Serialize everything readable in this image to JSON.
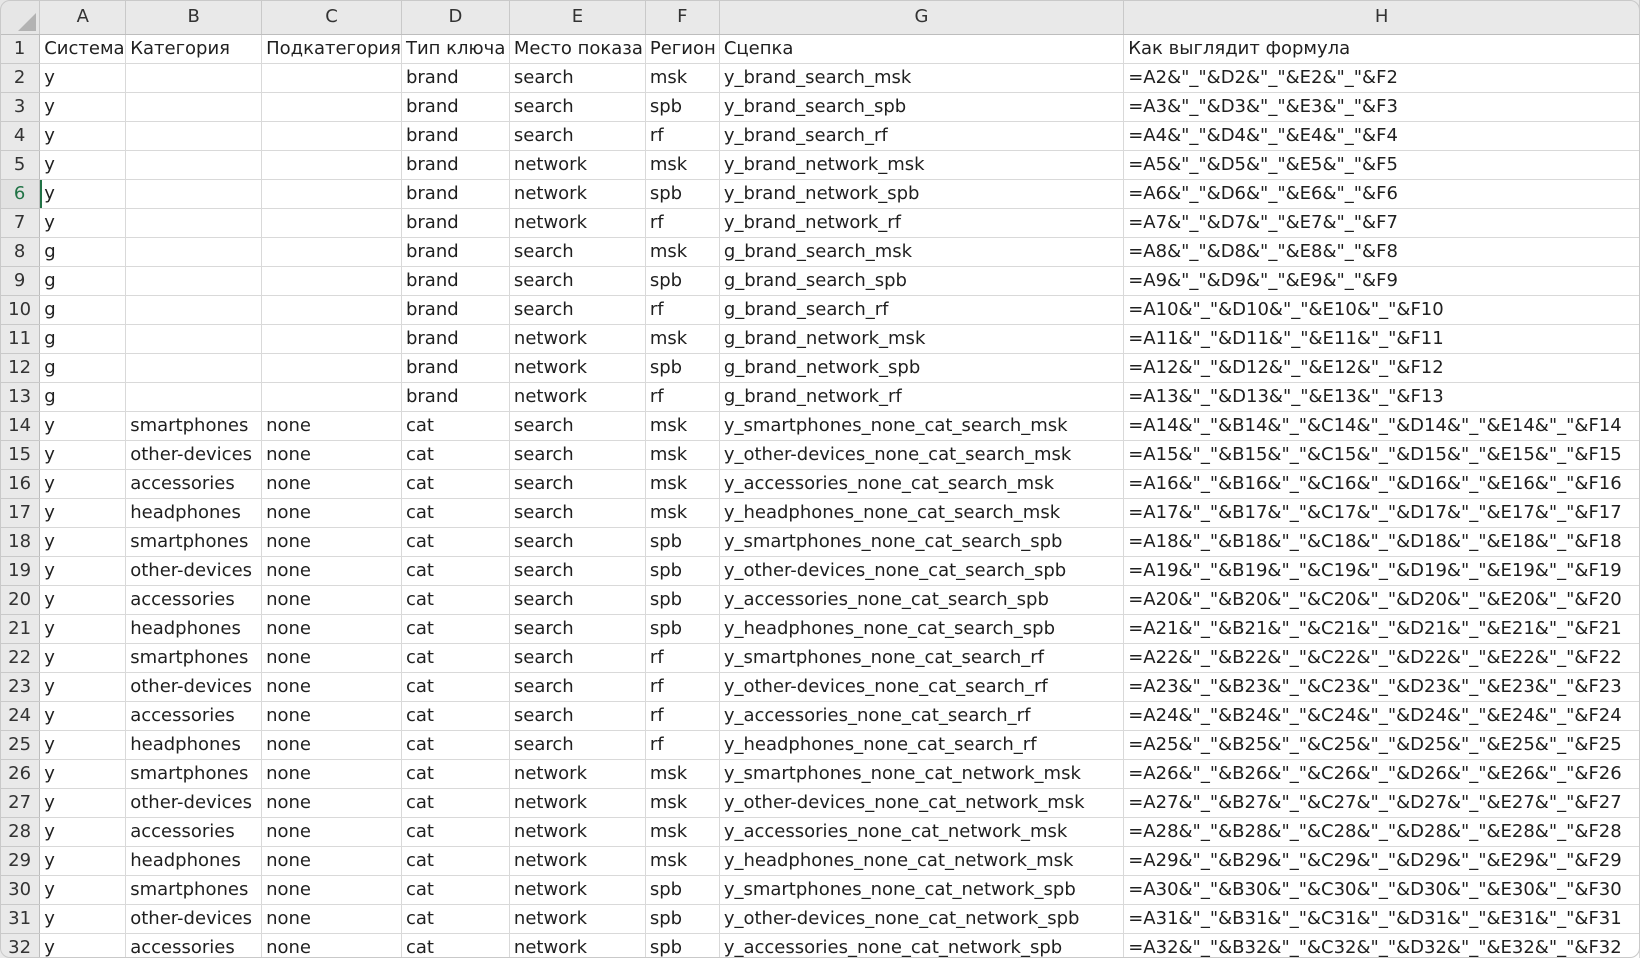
{
  "corner": "",
  "columns": [
    "A",
    "B",
    "C",
    "D",
    "E",
    "F",
    "G",
    "H"
  ],
  "row_numbers": [
    1,
    2,
    3,
    4,
    5,
    6,
    7,
    8,
    9,
    10,
    11,
    12,
    13,
    14,
    15,
    16,
    17,
    18,
    19,
    20,
    21,
    22,
    23,
    24,
    25,
    26,
    27,
    28,
    29,
    30,
    31,
    32
  ],
  "selected_row": 6,
  "rows": [
    [
      "Система",
      "Категория",
      "Подкатегория",
      "Тип ключа",
      "Место показа",
      "Регион",
      "Сцепка",
      "Как выглядит формула"
    ],
    [
      "y",
      "",
      "",
      "brand",
      "search",
      "msk",
      "y_brand_search_msk",
      "=A2&\"_\"&D2&\"_\"&E2&\"_\"&F2"
    ],
    [
      "y",
      "",
      "",
      "brand",
      "search",
      "spb",
      "y_brand_search_spb",
      "=A3&\"_\"&D3&\"_\"&E3&\"_\"&F3"
    ],
    [
      "y",
      "",
      "",
      "brand",
      "search",
      "rf",
      "y_brand_search_rf",
      "=A4&\"_\"&D4&\"_\"&E4&\"_\"&F4"
    ],
    [
      "y",
      "",
      "",
      "brand",
      "network",
      "msk",
      "y_brand_network_msk",
      "=A5&\"_\"&D5&\"_\"&E5&\"_\"&F5"
    ],
    [
      "y",
      "",
      "",
      "brand",
      "network",
      "spb",
      "y_brand_network_spb",
      "=A6&\"_\"&D6&\"_\"&E6&\"_\"&F6"
    ],
    [
      "y",
      "",
      "",
      "brand",
      "network",
      "rf",
      "y_brand_network_rf",
      "=A7&\"_\"&D7&\"_\"&E7&\"_\"&F7"
    ],
    [
      "g",
      "",
      "",
      "brand",
      "search",
      "msk",
      "g_brand_search_msk",
      "=A8&\"_\"&D8&\"_\"&E8&\"_\"&F8"
    ],
    [
      "g",
      "",
      "",
      "brand",
      "search",
      "spb",
      "g_brand_search_spb",
      "=A9&\"_\"&D9&\"_\"&E9&\"_\"&F9"
    ],
    [
      "g",
      "",
      "",
      "brand",
      "search",
      "rf",
      "g_brand_search_rf",
      "=A10&\"_\"&D10&\"_\"&E10&\"_\"&F10"
    ],
    [
      "g",
      "",
      "",
      "brand",
      "network",
      "msk",
      "g_brand_network_msk",
      "=A11&\"_\"&D11&\"_\"&E11&\"_\"&F11"
    ],
    [
      "g",
      "",
      "",
      "brand",
      "network",
      "spb",
      "g_brand_network_spb",
      "=A12&\"_\"&D12&\"_\"&E12&\"_\"&F12"
    ],
    [
      "g",
      "",
      "",
      "brand",
      "network",
      "rf",
      "g_brand_network_rf",
      "=A13&\"_\"&D13&\"_\"&E13&\"_\"&F13"
    ],
    [
      "y",
      "smartphones",
      "none",
      "cat",
      "search",
      "msk",
      "y_smartphones_none_cat_search_msk",
      "=A14&\"_\"&B14&\"_\"&C14&\"_\"&D14&\"_\"&E14&\"_\"&F14"
    ],
    [
      "y",
      "other-devices",
      "none",
      "cat",
      "search",
      "msk",
      "y_other-devices_none_cat_search_msk",
      "=A15&\"_\"&B15&\"_\"&C15&\"_\"&D15&\"_\"&E15&\"_\"&F15"
    ],
    [
      "y",
      "accessories",
      "none",
      "cat",
      "search",
      "msk",
      "y_accessories_none_cat_search_msk",
      "=A16&\"_\"&B16&\"_\"&C16&\"_\"&D16&\"_\"&E16&\"_\"&F16"
    ],
    [
      "y",
      "headphones",
      "none",
      "cat",
      "search",
      "msk",
      "y_headphones_none_cat_search_msk",
      "=A17&\"_\"&B17&\"_\"&C17&\"_\"&D17&\"_\"&E17&\"_\"&F17"
    ],
    [
      "y",
      "smartphones",
      "none",
      "cat",
      "search",
      "spb",
      "y_smartphones_none_cat_search_spb",
      "=A18&\"_\"&B18&\"_\"&C18&\"_\"&D18&\"_\"&E18&\"_\"&F18"
    ],
    [
      "y",
      "other-devices",
      "none",
      "cat",
      "search",
      "spb",
      "y_other-devices_none_cat_search_spb",
      "=A19&\"_\"&B19&\"_\"&C19&\"_\"&D19&\"_\"&E19&\"_\"&F19"
    ],
    [
      "y",
      "accessories",
      "none",
      "cat",
      "search",
      "spb",
      "y_accessories_none_cat_search_spb",
      "=A20&\"_\"&B20&\"_\"&C20&\"_\"&D20&\"_\"&E20&\"_\"&F20"
    ],
    [
      "y",
      "headphones",
      "none",
      "cat",
      "search",
      "spb",
      "y_headphones_none_cat_search_spb",
      "=A21&\"_\"&B21&\"_\"&C21&\"_\"&D21&\"_\"&E21&\"_\"&F21"
    ],
    [
      "y",
      "smartphones",
      "none",
      "cat",
      "search",
      "rf",
      "y_smartphones_none_cat_search_rf",
      "=A22&\"_\"&B22&\"_\"&C22&\"_\"&D22&\"_\"&E22&\"_\"&F22"
    ],
    [
      "y",
      "other-devices",
      "none",
      "cat",
      "search",
      "rf",
      "y_other-devices_none_cat_search_rf",
      "=A23&\"_\"&B23&\"_\"&C23&\"_\"&D23&\"_\"&E23&\"_\"&F23"
    ],
    [
      "y",
      "accessories",
      "none",
      "cat",
      "search",
      "rf",
      "y_accessories_none_cat_search_rf",
      "=A24&\"_\"&B24&\"_\"&C24&\"_\"&D24&\"_\"&E24&\"_\"&F24"
    ],
    [
      "y",
      "headphones",
      "none",
      "cat",
      "search",
      "rf",
      "y_headphones_none_cat_search_rf",
      "=A25&\"_\"&B25&\"_\"&C25&\"_\"&D25&\"_\"&E25&\"_\"&F25"
    ],
    [
      "y",
      "smartphones",
      "none",
      "cat",
      "network",
      "msk",
      "y_smartphones_none_cat_network_msk",
      "=A26&\"_\"&B26&\"_\"&C26&\"_\"&D26&\"_\"&E26&\"_\"&F26"
    ],
    [
      "y",
      "other-devices",
      "none",
      "cat",
      "network",
      "msk",
      "y_other-devices_none_cat_network_msk",
      "=A27&\"_\"&B27&\"_\"&C27&\"_\"&D27&\"_\"&E27&\"_\"&F27"
    ],
    [
      "y",
      "accessories",
      "none",
      "cat",
      "network",
      "msk",
      "y_accessories_none_cat_network_msk",
      "=A28&\"_\"&B28&\"_\"&C28&\"_\"&D28&\"_\"&E28&\"_\"&F28"
    ],
    [
      "y",
      "headphones",
      "none",
      "cat",
      "network",
      "msk",
      "y_headphones_none_cat_network_msk",
      "=A29&\"_\"&B29&\"_\"&C29&\"_\"&D29&\"_\"&E29&\"_\"&F29"
    ],
    [
      "y",
      "smartphones",
      "none",
      "cat",
      "network",
      "spb",
      "y_smartphones_none_cat_network_spb",
      "=A30&\"_\"&B30&\"_\"&C30&\"_\"&D30&\"_\"&E30&\"_\"&F30"
    ],
    [
      "y",
      "other-devices",
      "none",
      "cat",
      "network",
      "spb",
      "y_other-devices_none_cat_network_spb",
      "=A31&\"_\"&B31&\"_\"&C31&\"_\"&D31&\"_\"&E31&\"_\"&F31"
    ],
    [
      "y",
      "accessories",
      "none",
      "cat",
      "network",
      "spb",
      "y_accessories_none_cat_network_spb",
      "=A32&\"_\"&B32&\"_\"&C32&\"_\"&D32&\"_\"&E32&\"_\"&F32"
    ]
  ]
}
